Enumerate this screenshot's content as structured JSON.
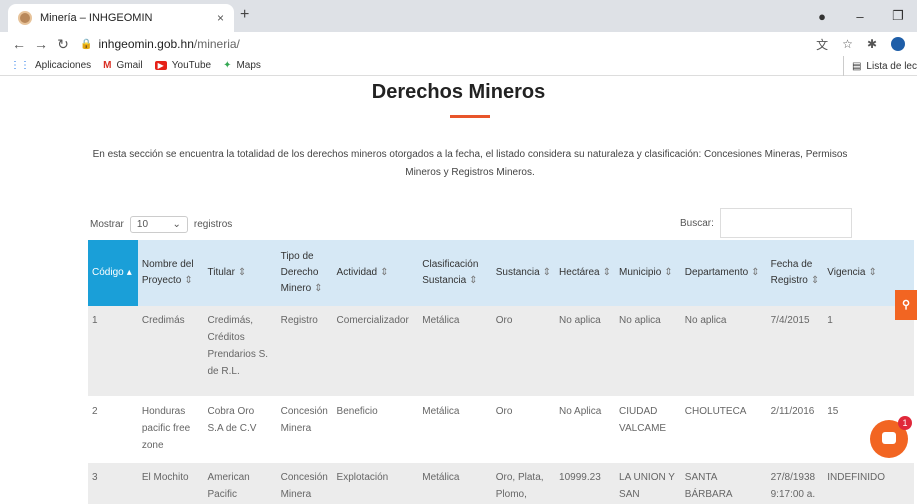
{
  "browser": {
    "tab_title": "Minería – INHGEOMIN",
    "tab_close": "×",
    "new_tab": "+",
    "url_domain": "inhgeomin.gob.hn",
    "url_path": "/mineria/",
    "bookmarks": [
      {
        "label": "Aplicaciones",
        "icon": "apps-icon"
      },
      {
        "label": "Gmail",
        "icon": "gmail-icon"
      },
      {
        "label": "YouTube",
        "icon": "youtube-icon"
      },
      {
        "label": "Maps",
        "icon": "maps-icon"
      }
    ],
    "reading_list": "Lista de lec"
  },
  "page": {
    "title": "Derechos Mineros",
    "description": "En esta sección se encuentra la totalidad de los derechos mineros otorgados a la fecha, el listado considera su naturaleza y clasificación: Concesiones Mineras, Permisos Mineros y Registros Mineros.",
    "show_label": "Mostrar",
    "show_value": "10",
    "records_label": "registros",
    "search_label": "Buscar:",
    "accent_color": "#e8552a",
    "header_color": "#d6e8f5",
    "sorted_header_color": "#1a9fd8"
  },
  "table": {
    "headers": [
      "Código",
      "Nombre del Proyecto",
      "Titular",
      "Tipo de Derecho Minero",
      "Actividad",
      "Clasificación Sustancia",
      "Sustancia",
      "Hectárea",
      "Municipio",
      "Departamento",
      "Fecha de Registro",
      "Vigencia"
    ],
    "rows": [
      [
        "1",
        "Credimás",
        "Credimás, Créditos Prendarios S. de R.L.",
        "Registro",
        "Comercializador",
        "Metálica",
        "Oro",
        "No aplica",
        "No aplica",
        "No aplica",
        "7/4/2015",
        "1"
      ],
      [
        "2",
        "Honduras pacific free zone",
        "Cobra Oro S.A de C.V",
        "Concesión Minera",
        "Beneficio",
        "Metálica",
        "Oro",
        "No Aplica",
        "CIUDAD VALCAME",
        "CHOLUTECA",
        "2/11/2016",
        "15"
      ],
      [
        "3",
        "El Mochito",
        "American Pacific",
        "Concesión Minera",
        "Explotación",
        "Metálica",
        "Oro, Plata, Plomo,",
        "10999.23",
        "LA UNION Y SAN",
        "SANTA BÁRBARA",
        "27/8/1938 9:17:00 a.",
        "INDEFINIDO"
      ]
    ]
  },
  "widgets": {
    "chat_badge": "1"
  }
}
